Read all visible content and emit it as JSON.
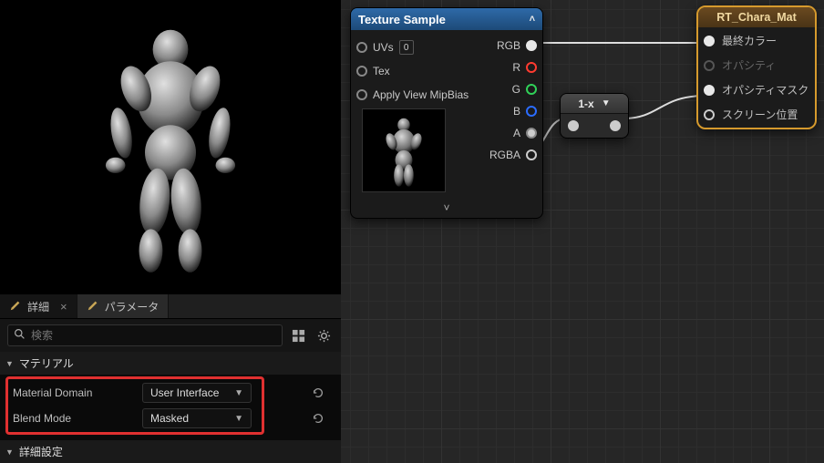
{
  "left": {
    "tabs": {
      "details": "詳細",
      "parameters": "パラメータ"
    },
    "search_placeholder": "検索",
    "section_material": "マテリアル",
    "props": {
      "material_domain": {
        "label": "Material Domain",
        "value": "User Interface"
      },
      "blend_mode": {
        "label": "Blend Mode",
        "value": "Masked"
      }
    },
    "section_advanced": "詳細設定"
  },
  "nodes": {
    "texture_sample": {
      "title": "Texture Sample",
      "inputs": {
        "uvs": "UVs",
        "uvs_index": "0",
        "tex": "Tex",
        "apply_mip": "Apply View MipBias"
      },
      "outputs": {
        "rgb": "RGB",
        "r": "R",
        "g": "G",
        "b": "B",
        "a": "A",
        "rgba": "RGBA"
      }
    },
    "one_minus": {
      "title": "1-x"
    },
    "material_output": {
      "title": "RT_Chara_Mat",
      "pins": {
        "final_color": "最終カラー",
        "opacity": "オパシティ",
        "opacity_mask": "オパシティマスク",
        "screen_pos": "スクリーン位置"
      }
    }
  }
}
